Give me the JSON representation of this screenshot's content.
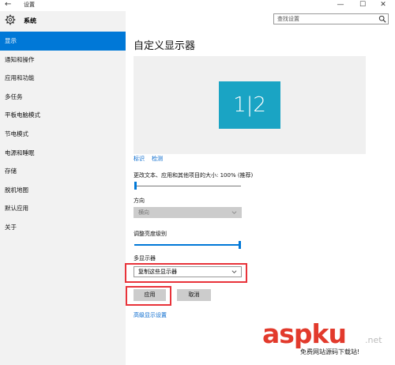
{
  "window": {
    "title": "设置",
    "back_glyph": "←",
    "min_glyph": "—",
    "max_glyph": "☐",
    "close_glyph": "✕"
  },
  "sidebar": {
    "brand": "系统",
    "items": [
      {
        "label": "显示",
        "active": true
      },
      {
        "label": "通知和操作"
      },
      {
        "label": "应用和功能"
      },
      {
        "label": "多任务"
      },
      {
        "label": "平板电脑模式"
      },
      {
        "label": "节电模式"
      },
      {
        "label": "电源和睡眠"
      },
      {
        "label": "存储"
      },
      {
        "label": "脱机地图"
      },
      {
        "label": "默认应用"
      },
      {
        "label": "关于"
      }
    ]
  },
  "search": {
    "placeholder": "查找设置"
  },
  "main": {
    "title": "自定义显示器",
    "monitor_label": "1|2",
    "identify_link": "标识",
    "detect_link": "检测",
    "scale_label": "更改文本、应用和其他项目的大小: 100% (推荐)",
    "scale_percent": 100,
    "orientation_label": "方向",
    "orientation_value": "横向",
    "brightness_label": "调整亮度级别",
    "brightness_percent": 100,
    "multi_display_label": "多显示器",
    "multi_display_value": "复制这些显示器",
    "apply_button": "应用",
    "cancel_button": "取消",
    "advanced_link": "高级显示设置"
  },
  "colors": {
    "accent": "#0078d7",
    "highlight_box": "#e8333a",
    "monitor_tile": "#1aa4c4"
  },
  "watermark": {
    "brand_asp": "asp",
    "brand_ku": "ku",
    "brand_net": ".net",
    "subtitle": "免费网站源码下载站!"
  }
}
